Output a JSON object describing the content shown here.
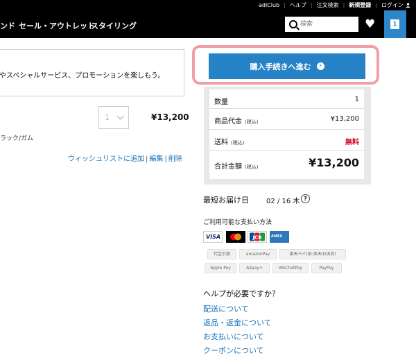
{
  "utility_bar": {
    "links": [
      "adiClub",
      "ヘルプ",
      "注文検索",
      "新規登録",
      "ログイン"
    ]
  },
  "nav": {
    "items": [
      "ンド",
      "セール・アウトレット",
      "スタイリング"
    ],
    "search_placeholder": "検索",
    "cart_count": "1",
    "icons": [
      "search-icon",
      "heart-icon",
      "bag-icon"
    ]
  },
  "promo": {
    "text": "やスペシャルサービス、プロモーションを楽しもう。"
  },
  "cart_item": {
    "quantity": "1",
    "price": "¥13,200",
    "color_text": "ラック/ガム",
    "actions": [
      "ウィッシュリストに追加",
      "編集",
      "削除"
    ]
  },
  "checkout": {
    "button_label": "購入手続きへ進む",
    "icon": "arrow-circle-icon"
  },
  "summary": {
    "qty_label": "数量",
    "qty_value": "1",
    "subtotal_label": "商品代金",
    "subtotal_note": "(税込)",
    "subtotal_value": "¥13,200",
    "shipping_label": "送料",
    "shipping_note": "(税込)",
    "shipping_value": "無料",
    "total_label": "合計金額",
    "total_note": "(税込)",
    "total_value": "¥13,200"
  },
  "delivery": {
    "label": "最短お届け日",
    "date": "02 / 16 木",
    "help_symbol": "?"
  },
  "payment": {
    "title": "ご利用可能な支払い方法",
    "cards": [
      "VISA",
      "mastercard",
      "JCB",
      "AMEX"
    ],
    "methods_row1": [
      "代金引換",
      "amazonPay",
      "楽天ペイ(旧:楽天ID決済)"
    ],
    "methods_row2": [
      "Apple Pay",
      "Alipay+",
      "WeChatPay",
      "PayPay"
    ]
  },
  "help": {
    "title": "ヘルプが必要ですか？",
    "links": [
      "配送について",
      "返品・返金について",
      "お支払いについて",
      "クーポンについて"
    ]
  },
  "colors": {
    "accent_blue": "#2582c6",
    "highlight_pink": "#f0a0a5",
    "free_red": "#d0021b"
  }
}
